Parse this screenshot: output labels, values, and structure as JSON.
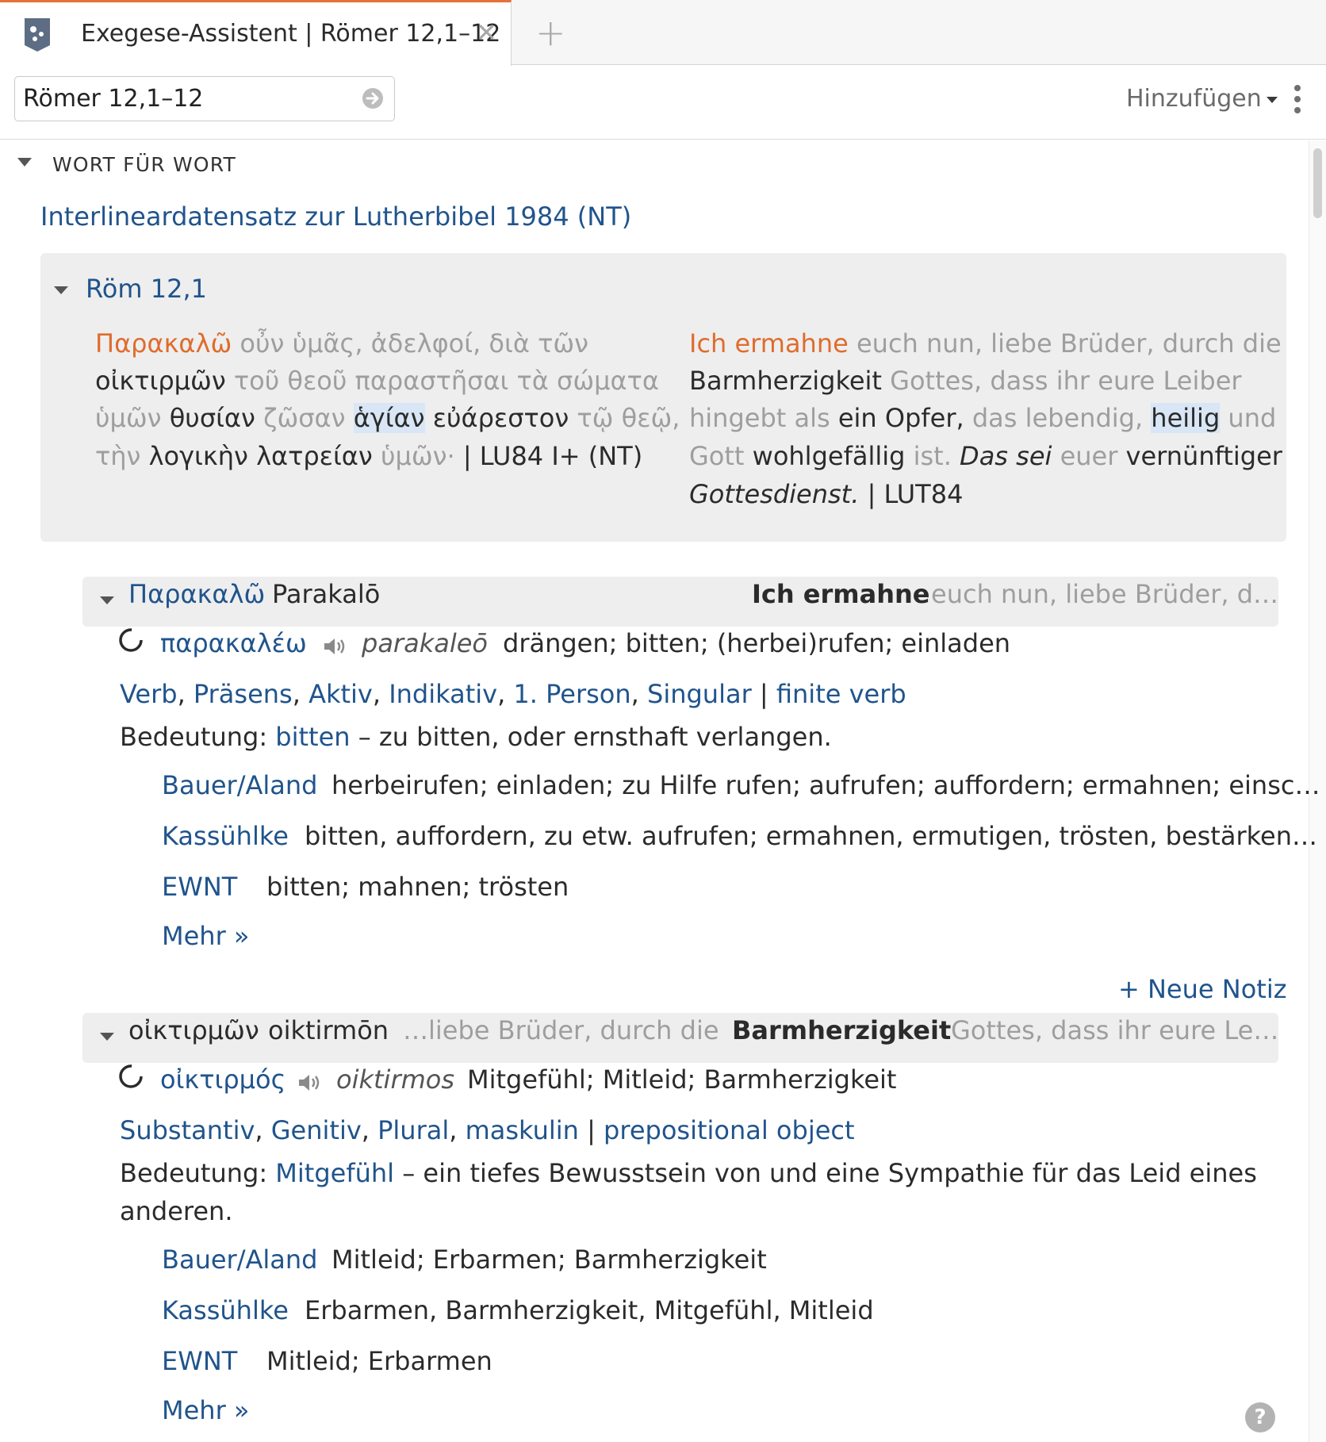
{
  "tab": {
    "title": "Exegese-Assistent | Römer 12,1–12",
    "close_glyph": "✕",
    "new_glyph": "+"
  },
  "toolbar": {
    "reference_value": "Römer 12,1–12",
    "add_label": "Hinzufügen"
  },
  "section": {
    "title": "WORT FÜR WORT",
    "dataset": "Interlineardatensatz zur Lutherbibel 1984 (NT)"
  },
  "verse": {
    "ref": "Röm 12,1",
    "greek": {
      "l1": [
        "Παρακαλῶ",
        " οὖν ὑμᾶς, ἀδελφοί, διὰ τῶν"
      ],
      "l2": [
        "οἰκτιρμῶν",
        " τοῦ θεοῦ παραστῆσαι τὰ σώματα"
      ],
      "l3": [
        "ὑμῶν",
        " θυσίαν",
        " ζῶσαν ",
        "ἁγίαν",
        " εὐάρεστον",
        " τῷ θεῷ,"
      ],
      "l4": [
        "τὴν",
        " λογικὴν λατρείαν",
        " ὑμῶν·",
        "  | LU84 I+ (NT)"
      ]
    },
    "german": {
      "l1": [
        "Ich ermahne",
        " euch nun, liebe Brüder, durch die"
      ],
      "l2": [
        "Barmherzigkeit",
        " Gottes, dass ihr eure Leiber"
      ],
      "l3": [
        "hingebt als",
        " ein Opfer,",
        " das lebendig, ",
        "heilig",
        " und"
      ],
      "l4": [
        "Gott",
        " wohlgefällig",
        " ist. ",
        "Das sei",
        " euer",
        " vernünftiger"
      ],
      "l5": [
        "Gottesdienst.",
        "  | LUT84"
      ]
    }
  },
  "words": [
    {
      "greek": "Παρακαλῶ",
      "translit": "Parakalō",
      "german_bold": "Ich ermahne",
      "german_context": "euch nun, liebe Brüder, d…",
      "lemma": "παρακαλέω",
      "lemma_translit": "parakaleō",
      "gloss": "drängen; bitten; (herbei)rufen; einladen",
      "morph": [
        "Verb",
        "Präsens",
        "Aktiv",
        "Indikativ",
        "1. Person",
        "Singular"
      ],
      "syntax": "finite verb",
      "meaning_label": "Bedeutung:",
      "meaning_word": "bitten",
      "meaning_text": " – zu bitten, oder ernsthaft verlangen.",
      "lexicons": [
        {
          "name": "Bauer/Aland",
          "text": "herbeirufen; einladen; zu Hilfe rufen; aufrufen; auffordern; ermahnen; einsc…"
        },
        {
          "name": "Kassühlke",
          "text": "bitten, auffordern, zu etw. aufrufen; ermahnen, ermutigen, trösten, bestärken…"
        },
        {
          "name": "EWNT",
          "text": "bitten; mahnen; trösten"
        }
      ],
      "more": "Mehr »",
      "new_note": "+ Neue Notiz"
    },
    {
      "greek": "οἰκτιρμῶν",
      "translit": "oiktirmōn",
      "german_pre": "…liebe Brüder, durch die",
      "german_bold": "Barmherzigkeit",
      "german_context": "Gottes, dass ihr eure Le…",
      "lemma": "οἰκτιρμός",
      "lemma_translit": "oiktirmos",
      "gloss": "Mitgefühl; Mitleid; Barmherzigkeit",
      "morph": [
        "Substantiv",
        "Genitiv",
        "Plural",
        "maskulin"
      ],
      "syntax": "prepositional object",
      "meaning_label": "Bedeutung:",
      "meaning_word": "Mitgefühl",
      "meaning_text": " – ein tiefes Bewusstsein von und eine Sympathie für das Leid eines",
      "meaning_text2": "anderen.",
      "lexicons": [
        {
          "name": "Bauer/Aland",
          "text": "Mitleid; Erbarmen; Barmherzigkeit"
        },
        {
          "name": "Kassühlke",
          "text": "Erbarmen, Barmherzigkeit, Mitgefühl, Mitleid"
        },
        {
          "name": "EWNT",
          "text": "Mitleid; Erbarmen"
        }
      ],
      "more": "Mehr »"
    }
  ],
  "help": "?",
  "colors": {
    "accent": "#e4723a",
    "link": "#20548c",
    "highlight": "#d8e6f5",
    "panel": "#eeeeee"
  }
}
